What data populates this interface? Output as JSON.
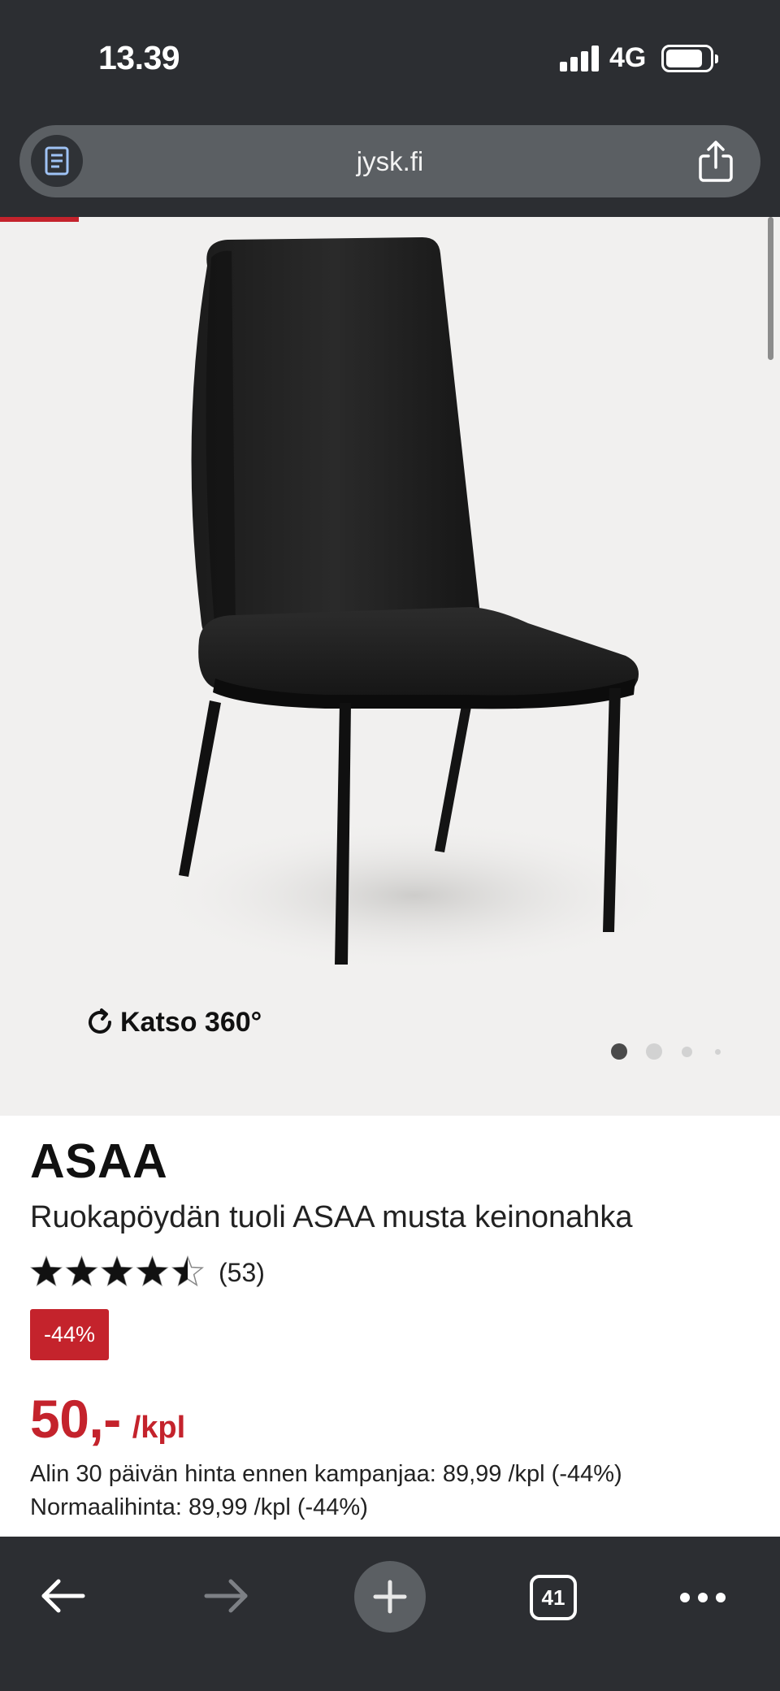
{
  "status_bar": {
    "time": "13.39",
    "network": "4G"
  },
  "browser": {
    "url": "jysk.fi",
    "tab_count": "41"
  },
  "gallery": {
    "view_360_label": "Katso 360°",
    "image_count": 4,
    "active_index": 0
  },
  "product": {
    "brand": "ASAA",
    "title": "Ruokapöydän tuoli ASAA musta keinonahka",
    "rating": 4.5,
    "rating_max": 5,
    "review_count": "(53)",
    "discount_badge": "-44%",
    "price": "50,-",
    "price_unit": "/kpl",
    "lowest_price_line": "Alin 30 päivän hinta ennen kampanjaa: 89,99 /kpl (-44%)",
    "normal_price_line": "Normaalihinta: 89,99 /kpl (-44%)"
  },
  "colors": {
    "accent_red": "#c4232c",
    "browser_chrome": "#2c2e32",
    "image_background": "#f1f0ef"
  }
}
